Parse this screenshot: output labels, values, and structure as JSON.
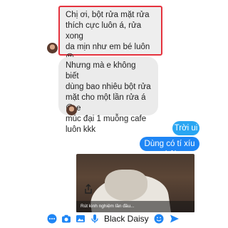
{
  "messages": {
    "incoming_1": "Chị ơi, bột rửa mặt rửa\nthích cực luôn á, rửa xong\nda mịn như em bé luôn 😍\n😍😍",
    "incoming_2": "Nhưng mà e không biết\ndùng bao nhiêu bột rửa\nmặt cho một lần rửa á 😅 e\nmúc đại 1 muỗng cafe\nluôn kkk",
    "outgoing_1": "Trời ui",
    "outgoing_2": "Dùng có tí xíu thôi"
  },
  "photo": {
    "caption": "Rút kinh nghiệm lần đầu..."
  },
  "composer": {
    "text": "Black Daisy",
    "icons": [
      "more-dots-icon",
      "camera-icon",
      "photo-icon",
      "microphone-icon",
      "emoji-icon",
      "send-icon"
    ]
  },
  "colors": {
    "incoming_bg": "#ebebeb",
    "outgoing_light": "#2aa6f2",
    "outgoing_dark": "#1f86f5",
    "highlight_border": "#e5323e",
    "accent": "#1f86f5"
  }
}
